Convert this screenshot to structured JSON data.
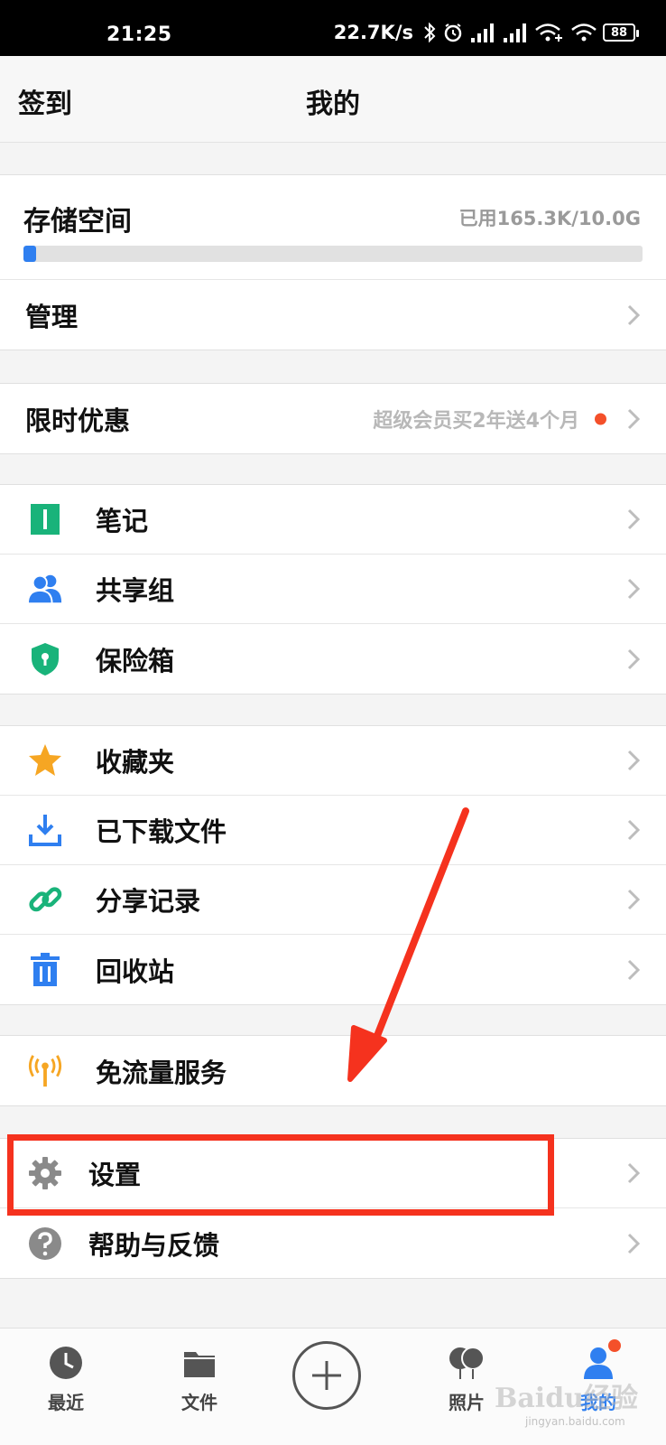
{
  "status_bar": {
    "time": "21:25",
    "speed": "22.7K/s",
    "battery": "88"
  },
  "header": {
    "left_action": "签到",
    "title": "我的"
  },
  "storage": {
    "title": "存储空间",
    "used_text": "已用165.3K/10.0G",
    "progress_fraction": 0.02,
    "manage_label": "管理"
  },
  "promo": {
    "label": "限时优惠",
    "subtitle": "超级会员买2年送4个月"
  },
  "group1": [
    {
      "label": "笔记",
      "icon": "note-icon",
      "color": "#19b37a"
    },
    {
      "label": "共享组",
      "icon": "group-icon",
      "color": "#2f7ff0"
    },
    {
      "label": "保险箱",
      "icon": "shield-icon",
      "color": "#19b37a"
    }
  ],
  "group2": [
    {
      "label": "收藏夹",
      "icon": "star-icon",
      "color": "#f6a623"
    },
    {
      "label": "已下载文件",
      "icon": "download-icon",
      "color": "#2f7ff0"
    },
    {
      "label": "分享记录",
      "icon": "link-icon",
      "color": "#19b37a"
    },
    {
      "label": "回收站",
      "icon": "trash-icon",
      "color": "#2f7ff0"
    }
  ],
  "group3": [
    {
      "label": "免流量服务",
      "icon": "antenna-icon",
      "color": "#f6a623"
    }
  ],
  "group4": [
    {
      "label": "设置",
      "icon": "gear-icon",
      "color": "#8a8a8a"
    },
    {
      "label": "帮助与反馈",
      "icon": "help-icon",
      "color": "#8a8a8a"
    }
  ],
  "tabbar": {
    "recent": "最近",
    "files": "文件",
    "photos": "照片",
    "mine": "我的"
  },
  "watermark": {
    "main": "Baidu经验",
    "sub": "jingyan.baidu.com"
  },
  "colors": {
    "accent": "#2f7ff0",
    "badge": "#f4502a",
    "annotation": "#f5321e"
  }
}
